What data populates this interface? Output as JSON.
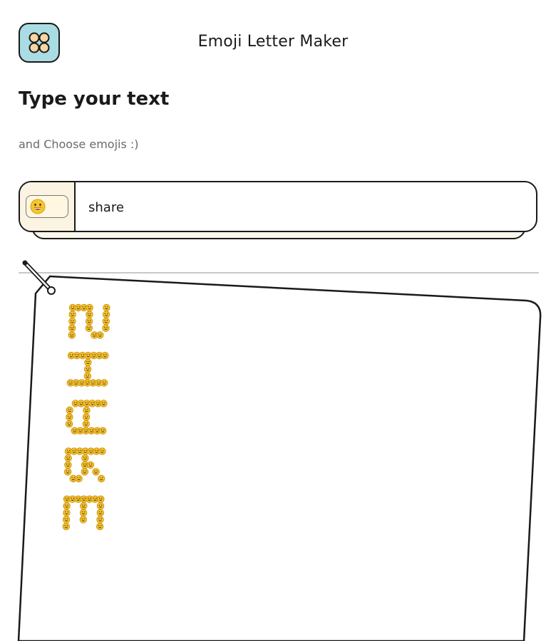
{
  "header": {
    "title": "Emoji Letter Maker",
    "icon": "grid-icon",
    "icon_color": "#a9dde3"
  },
  "intro": {
    "heading": "Type your text",
    "subheading": "and Choose emojis :)"
  },
  "input": {
    "value": "share",
    "selected_emoji": "grinning-face"
  },
  "preview": {
    "text": "SHARE",
    "emoji": "grinning-face",
    "emoji_color": "#f2c12e",
    "orientation": "rotated-vertical"
  }
}
